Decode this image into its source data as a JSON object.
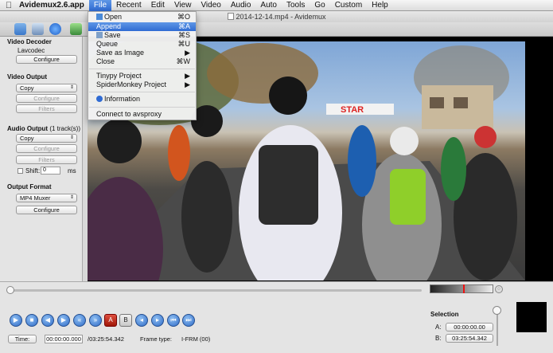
{
  "menubar": {
    "app_name": "Avidemux2.6.app",
    "items": [
      "File",
      "Recent",
      "Edit",
      "View",
      "Video",
      "Audio",
      "Auto",
      "Tools",
      "Go",
      "Custom",
      "Help"
    ]
  },
  "window": {
    "title": "2014-12-14.mp4 - Avidemux"
  },
  "file_menu": {
    "open": {
      "label": "Open",
      "shortcut": "⌘O"
    },
    "append": {
      "label": "Append",
      "shortcut": "⌘A"
    },
    "save": {
      "label": "Save",
      "shortcut": "⌘S"
    },
    "queue": {
      "label": "Queue",
      "shortcut": "⌘U"
    },
    "save_as_image": {
      "label": "Save as Image",
      "arrow": "▶"
    },
    "close": {
      "label": "Close",
      "shortcut": "⌘W"
    },
    "tinypy": {
      "label": "Tinypy Project",
      "arrow": "▶"
    },
    "spidermonkey": {
      "label": "SpiderMonkey Project",
      "arrow": "▶"
    },
    "information": {
      "label": "Information"
    },
    "avsproxy": {
      "label": "Connect to avsproxy"
    }
  },
  "left_panel": {
    "video_decoder": {
      "title": "Video Decoder",
      "codec": "Lavcodec",
      "configure": "Configure"
    },
    "video_output": {
      "title": "Video Output",
      "value": "Copy",
      "configure": "Configure",
      "filters": "Filters"
    },
    "audio_output": {
      "title": "Audio Output",
      "tracks": " (1 track(s))",
      "value": "Copy",
      "configure": "Configure",
      "filters": "Filters",
      "shift_label": "Shift:",
      "shift_value": "0",
      "shift_unit": "ms"
    },
    "output_format": {
      "title": "Output Format",
      "value": "MP4 Muxer",
      "configure": "Configure"
    }
  },
  "bottom": {
    "time_button": "Time:",
    "current_time": "00:00:00.000",
    "total_time": "/03:25:54.342",
    "frame_type_label": "Frame type:",
    "frame_type": "I-FRM (00)",
    "selection": {
      "title": "Selection",
      "a_label": "A:",
      "a_value": "00:00:00.00",
      "b_label": "B:",
      "b_value": "03:25:54.342"
    },
    "controls": [
      "play-icon",
      "stop-icon",
      "prev-frame-icon",
      "next-frame-icon",
      "prev-keyframe-icon",
      "next-keyframe-icon",
      "set-marker-a-icon",
      "set-marker-b-icon",
      "prev-black-icon",
      "next-black-icon",
      "goto-first-icon",
      "goto-last-icon",
      "goto-marker-icon"
    ]
  },
  "video_banner_text": "STAR"
}
